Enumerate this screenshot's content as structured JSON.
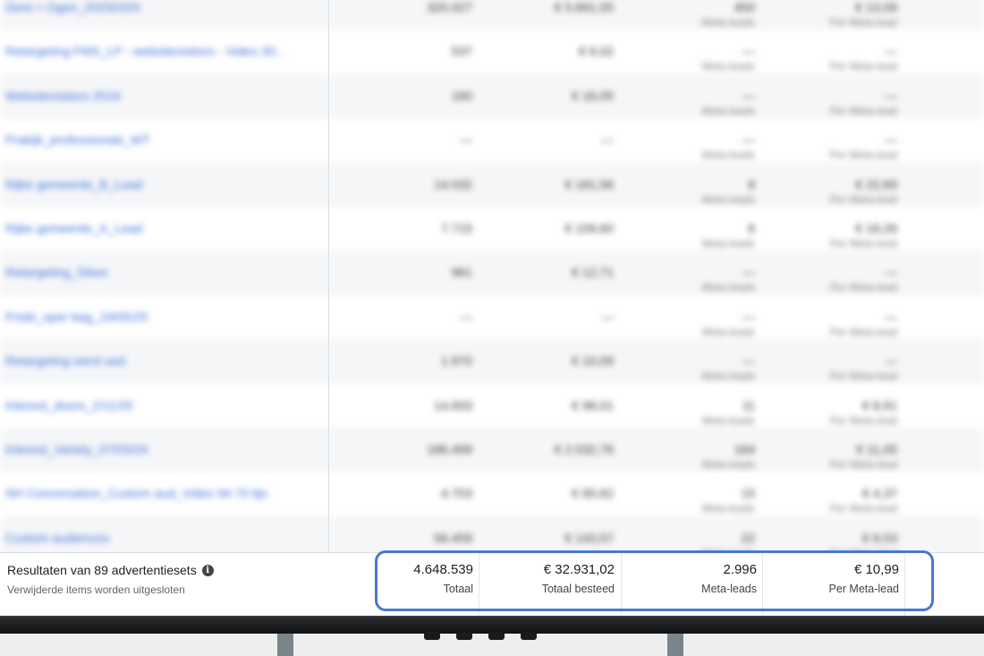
{
  "rows": [
    {
      "name": "Gent + Ogen_20250320",
      "c1": "320.027",
      "c2": "€ 5.891,55",
      "c3": "450",
      "c3_sub": "Meta-leads",
      "c4": "€ 13,09",
      "c4_sub": "Per Meta-lead"
    },
    {
      "name": "Retargeting FMS_LP - websitevisitors - Video 30...",
      "c1": "537",
      "c2": "€ 6,02",
      "c3": "—",
      "c3_sub": "Meta-leads",
      "c4": "—",
      "c4_sub": "Per Meta-lead"
    },
    {
      "name": "Websitevisitors 2016",
      "c1": "160",
      "c2": "€ 16,05",
      "c3": "—",
      "c3_sub": "Meta-leads",
      "c4": "—",
      "c4_sub": "Per Meta-lead"
    },
    {
      "name": "Prakijk_professionals_WT",
      "c1": "—",
      "c2": "—",
      "c3": "—",
      "c3_sub": "Meta-leads",
      "c4": "—",
      "c4_sub": "Per Meta-lead"
    },
    {
      "name": "Rijke gemeente_B_Lead",
      "c1": "14.032",
      "c2": "€ 181,56",
      "c3": "8",
      "c3_sub": "Meta-leads",
      "c4": "€ 22,69",
      "c4_sub": "Per Meta-lead"
    },
    {
      "name": "Rijke gemeente_A_Lead",
      "c1": "7.715",
      "c2": "€ 109,60",
      "c3": "6",
      "c3_sub": "Meta-leads",
      "c4": "€ 18,26",
      "c4_sub": "Per Meta-lead"
    },
    {
      "name": "Retargeting_Sikes",
      "c1": "961",
      "c2": "€ 12,71",
      "c3": "—",
      "c3_sub": "Meta-leads",
      "c4": "—",
      "c4_sub": "Per Meta-lead"
    },
    {
      "name": "Frisbi_oper bag_19/05/25",
      "c1": "—",
      "c2": "—",
      "c3": "—",
      "c3_sub": "Meta-leads",
      "c4": "—",
      "c4_sub": "Per Meta-lead"
    },
    {
      "name": "Retargeting werd ued",
      "c1": "1.970",
      "c2": "€ 10,09",
      "c3": "—",
      "c3_sub": "Meta-leads",
      "c4": "—",
      "c4_sub": "Per Meta-lead"
    },
    {
      "name": "Interest_doors_2/11/25",
      "c1": "14.833",
      "c2": "€ 98,01",
      "c3": "11",
      "c3_sub": "Meta-leads",
      "c4": "€ 8,91",
      "c4_sub": "Per Meta-lead"
    },
    {
      "name": "Interest_Variety_07/03/24",
      "c1": "186.499",
      "c2": "€ 2.032,76",
      "c3": "184",
      "c3_sub": "Meta-leads",
      "c4": "€ 11,05",
      "c4_sub": "Per Meta-lead"
    },
    {
      "name": "NH Conversation_Custom aud_Video 94 70 lijn",
      "c1": "4.703",
      "c2": "€ 65,62",
      "c3": "15",
      "c3_sub": "Meta-leads",
      "c4": "€ 4,37",
      "c4_sub": "Per Meta-lead"
    },
    {
      "name": "Custom audiences",
      "c1": "56.459",
      "c2": "€ 143,57",
      "c3": "22",
      "c3_sub": "Meta-leads",
      "c4": "€ 6,53",
      "c4_sub": "Per Meta-lead"
    }
  ],
  "footer": {
    "title": "Resultaten van 89 advertentiesets",
    "info_icon": "i",
    "subtitle": "Verwijderde items worden uitgesloten",
    "totals": [
      {
        "value": "4.648.539",
        "label": "Totaal"
      },
      {
        "value": "€ 32.931,02",
        "label": "Totaal besteed"
      },
      {
        "value": "2.996",
        "label": "Meta-leads"
      },
      {
        "value": "€ 10,99",
        "label": "Per Meta-lead"
      }
    ]
  },
  "colors": {
    "highlight": "#4a78d1",
    "link": "#3b6fd9"
  }
}
